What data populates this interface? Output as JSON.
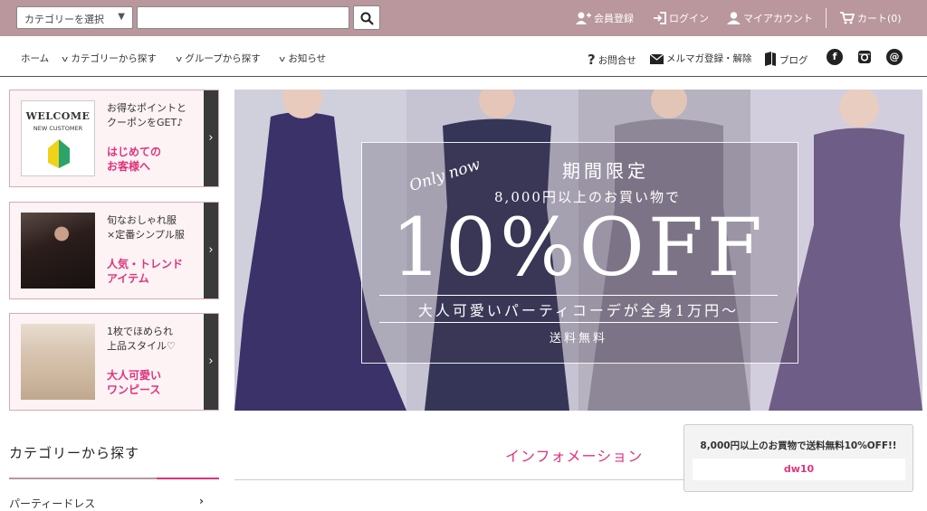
{
  "header": {
    "category_select_value": "カテゴリーを選択",
    "search_placeholder": "",
    "links": {
      "register": "会員登録",
      "login": "ログイン",
      "account": "マイアカウント",
      "cart": "カート(0)"
    }
  },
  "nav": {
    "home": "ホーム",
    "by_category": "カテゴリーから探す",
    "by_group": "グループから探す",
    "news": "お知らせ",
    "contact": "お問合せ",
    "newsletter": "メルマガ登録・解除",
    "blog": "ブログ",
    "social": [
      "f",
      "instagram",
      "@"
    ]
  },
  "promos": [
    {
      "card_title": "WELCOME",
      "card_sub": "NEW CUSTOMER",
      "text1": [
        "お得なポイントと",
        "クーポンをGET♪"
      ],
      "text2": [
        "はじめての",
        "お客様へ"
      ]
    },
    {
      "text1": [
        "旬なおしゃれ服",
        "×定番シンプル服"
      ],
      "text2": [
        "人気・トレンド",
        "アイテム"
      ]
    },
    {
      "text1": [
        "1枚でほめられ",
        "上品スタイル♡"
      ],
      "text2": [
        "大人可愛い",
        "ワンピース"
      ]
    }
  ],
  "hero": {
    "script": "Only now",
    "title": "期間限定",
    "subtitle": "8,000円以上のお買い物で",
    "big": "10%OFF",
    "tagline": "大人可愛いパーティコーデが全身1万円〜",
    "shipping": "送料無料"
  },
  "sidebar": {
    "section_title": "カテゴリーから探す",
    "first_item": "パーティードレス"
  },
  "main": {
    "info_title": "インフォメーション"
  },
  "coupon": {
    "text": "8,000円以上のお買物で送料無料10%OFF!!",
    "code": "dw10"
  },
  "colors": {
    "header_bg": "#b9979d",
    "accent_pink": "#e0337c"
  }
}
